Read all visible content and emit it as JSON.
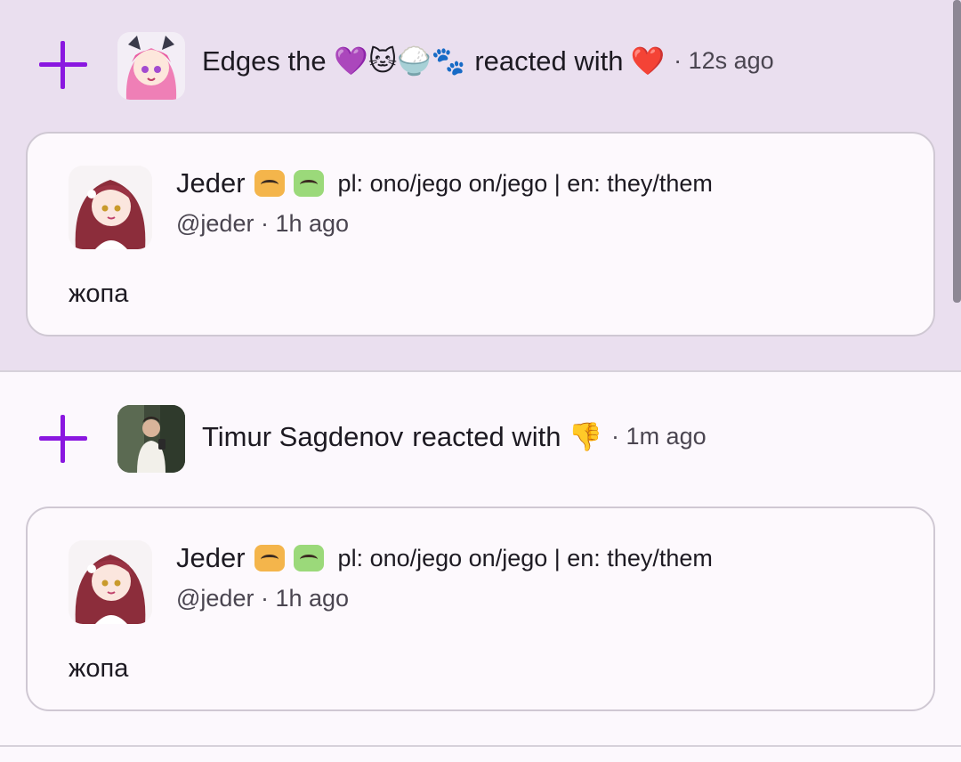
{
  "notifications": [
    {
      "reactor_name": "Edges the 💜🐱🍚🐾",
      "action": "reacted with",
      "reaction": "❤️",
      "time": "12s ago",
      "post": {
        "author_name": "Jeder",
        "pronouns": "pl: ono/jego on/jego | en: they/them",
        "handle": "@jeder",
        "time": "1h ago",
        "text": "жопа"
      }
    },
    {
      "reactor_name": "Timur Sagdenov",
      "action": "reacted with",
      "reaction": "👎",
      "time": "1m ago",
      "post": {
        "author_name": "Jeder",
        "pronouns": "pl: ono/jego on/jego | en: they/them",
        "handle": "@jeder",
        "time": "1h ago",
        "text": "жопа"
      }
    }
  ],
  "colors": {
    "accent": "#8a17e0",
    "unread_bg": "#eadfef",
    "card_border": "#cfc8d3"
  }
}
